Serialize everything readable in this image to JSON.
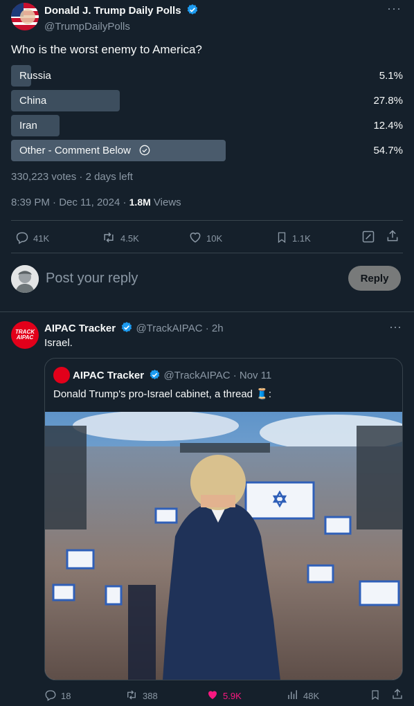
{
  "tweet": {
    "author_name": "Donald J. Trump Daily Polls",
    "author_handle": "@TrumpDailyPolls",
    "text": "Who is the worst enemy to America?",
    "poll": [
      {
        "label": "Russia",
        "percent_text": "5.1%",
        "percent": 5.1
      },
      {
        "label": "China",
        "percent_text": "27.8%",
        "percent": 27.8
      },
      {
        "label": "Iran",
        "percent_text": "12.4%",
        "percent": 12.4
      },
      {
        "label": "Other - Comment Below",
        "percent_text": "54.7%",
        "percent": 54.7
      }
    ],
    "votes_line": "330,223 votes · 2 days left",
    "timestamp": "8:39 PM · Dec 11, 2024 · ",
    "views_count": "1.8M",
    "views_label": " Views",
    "actions": {
      "replies": "41K",
      "retweets": "4.5K",
      "likes": "10K",
      "bookmarks": "1.1K"
    }
  },
  "reply_box": {
    "placeholder": "Post your reply",
    "button_label": "Reply"
  },
  "reply": {
    "author_name": "AIPAC Tracker",
    "author_handle": "@TrackAIPAC",
    "time": " · 2h",
    "text": "Israel.",
    "avatar_text": "TRACK AIPAC",
    "quote": {
      "author_name": "AIPAC Tracker",
      "author_handle": "@TrackAIPAC",
      "time": " · Nov 11",
      "text": "Donald Trump's pro-Israel cabinet, a thread 🧵:"
    },
    "actions": {
      "replies": "18",
      "retweets": "388",
      "likes": "5.9K",
      "views": "48K"
    }
  },
  "colors": {
    "background": "#15202b",
    "accent": "#1d9bf0",
    "like": "#f91880",
    "muted": "#8b98a5"
  }
}
